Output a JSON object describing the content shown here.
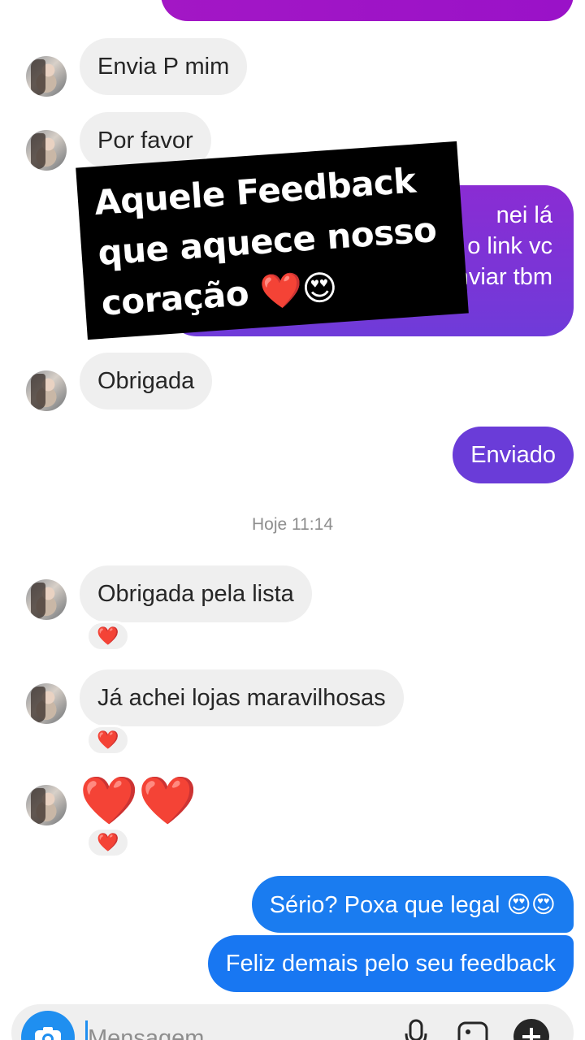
{
  "thread": {
    "messages_in_top": [
      {
        "text": "Envia P mim"
      },
      {
        "text": "Por favor"
      }
    ],
    "outgoing_partial_lines": [
      "nei lá",
      "o link vc",
      "enviar tbm"
    ],
    "message_obrigada": "Obrigada",
    "message_enviado": "Enviado",
    "timestamp": "Hoje 11:14",
    "messages_in_bottom": [
      {
        "text": "Obrigada pela lista",
        "reaction": "❤️"
      },
      {
        "text": "Já achei lojas maravilhosas",
        "reaction": "❤️"
      },
      {
        "text": "❤️❤️",
        "reaction": "❤️"
      }
    ],
    "messages_out_bottom": [
      {
        "text": "Sério? Poxa que legal 😍😍"
      },
      {
        "text": "Feliz demais pelo seu feedback"
      }
    ]
  },
  "overlay": {
    "lines": [
      "Aquele Feedback",
      "que aquece nosso",
      "coração ❤️😍"
    ]
  },
  "composer": {
    "placeholder": "Mensagem...",
    "icons": [
      "camera-icon",
      "microphone-icon",
      "gallery-icon",
      "plus-icon"
    ]
  },
  "colors": {
    "incoming_bubble": "#efefef",
    "outgoing_purple": "#7b2fd6",
    "outgoing_magenta": "#a215c6",
    "outgoing_blue": "#1877f2",
    "camera_button": "#1f8ff0"
  }
}
